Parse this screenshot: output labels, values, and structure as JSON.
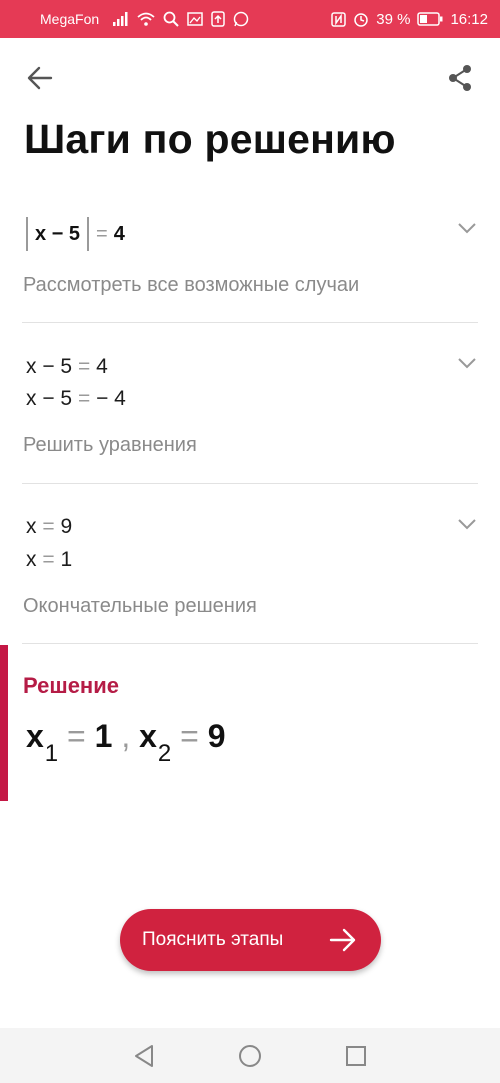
{
  "status_bar": {
    "carrier": "MegaFon",
    "battery": "39 %",
    "time": "16:12",
    "icons": [
      "signal-icon",
      "wifi-icon",
      "search-icon",
      "gallery-icon",
      "upload-icon",
      "whatsapp-icon",
      "nfc-icon",
      "alarm-icon",
      "battery-icon"
    ]
  },
  "toolbar": {
    "back_icon": "arrow-left-icon",
    "share_icon": "share-icon"
  },
  "page": {
    "title": "Шаги по решению"
  },
  "steps": [
    {
      "expression": {
        "inside": "x − 5",
        "equals": "=",
        "rhs": "4"
      },
      "description": "Рассмотреть все возможные случаи"
    },
    {
      "lines": [
        {
          "lhs": "x − 5",
          "eq": "=",
          "rhs": "4"
        },
        {
          "lhs": "x − 5",
          "eq": "=",
          "rhs": "− 4"
        }
      ],
      "description": "Решить уравнения"
    },
    {
      "lines": [
        {
          "lhs": "x",
          "eq": "=",
          "rhs": "9"
        },
        {
          "lhs": "x",
          "eq": "=",
          "rhs": "1"
        }
      ],
      "description": "Окончательные решения"
    }
  ],
  "solution": {
    "title": "Решение",
    "x1_var": "x",
    "x1_sub": "1",
    "eq": "=",
    "x1_val": "1",
    "sep": ",",
    "x2_var": "x",
    "x2_sub": "2",
    "x2_val": "9"
  },
  "actions": {
    "explain_label": "Пояснить этапы"
  },
  "colors": {
    "status_bar": "#e53a55",
    "accent": "#c41845",
    "button": "#d0223f",
    "muted": "#8a8a8a"
  }
}
